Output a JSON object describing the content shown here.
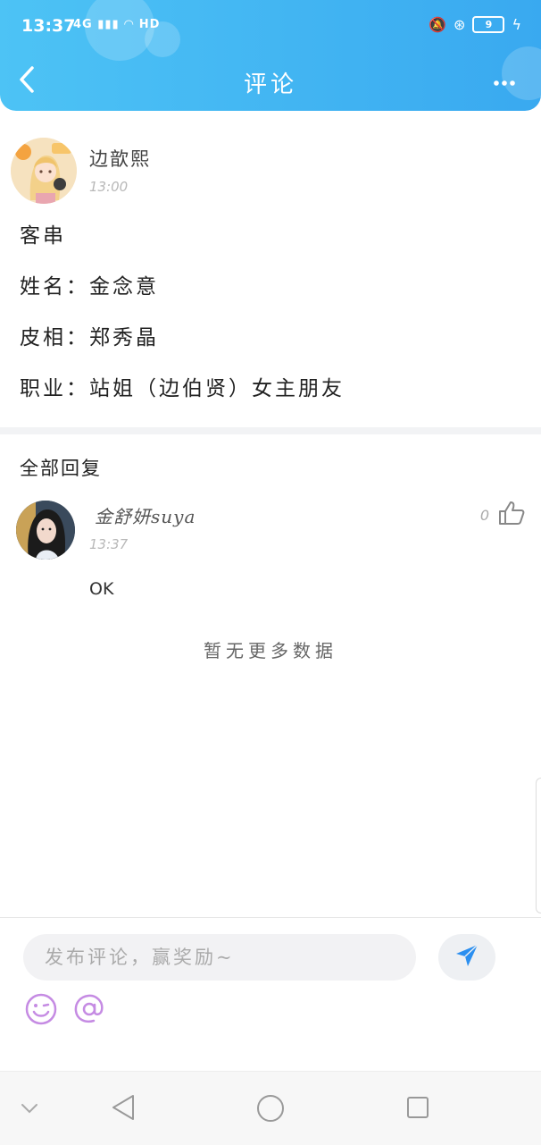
{
  "status_bar": {
    "time": "13:37",
    "network": "4G",
    "hd": "HD",
    "battery": "9"
  },
  "header": {
    "title": "评论"
  },
  "post": {
    "author": "边歆熙",
    "time": "13:00",
    "lines": [
      "客串",
      "姓名：金念意",
      "皮相：郑秀晶",
      "职业：站姐（边伯贤）女主朋友"
    ]
  },
  "replies": {
    "title": "全部回复",
    "items": [
      {
        "author": "金舒妍suya",
        "time": "13:37",
        "likes": "0",
        "text": "OK"
      }
    ],
    "no_more": "暂无更多数据"
  },
  "composer": {
    "placeholder": "发布评论，赢奖励~"
  },
  "colors": {
    "header_start": "#4dc3f5",
    "header_end": "#39a9f0",
    "send_icon": "#2b8ff0",
    "emoji_purple": "#c58be3"
  },
  "icons": [
    "back-icon",
    "more-icon",
    "like-icon",
    "send-icon",
    "emoji-icon",
    "at-icon",
    "nav-down-icon",
    "nav-back-icon",
    "nav-home-icon",
    "nav-recents-icon"
  ]
}
